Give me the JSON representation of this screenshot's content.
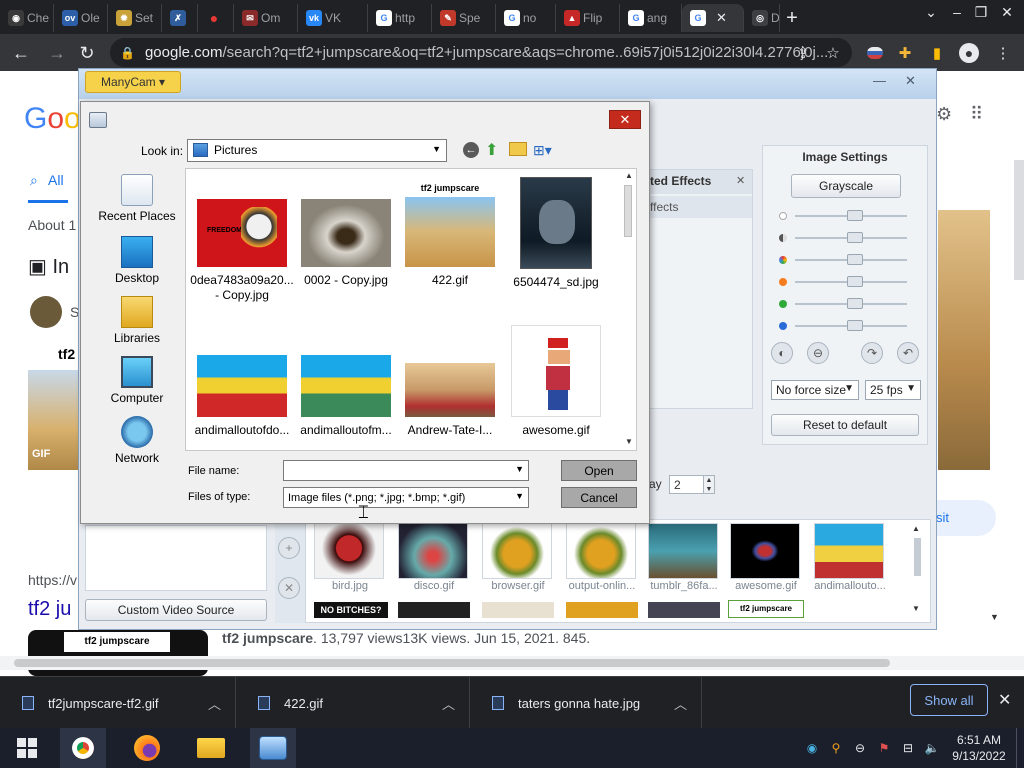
{
  "browser": {
    "tabs": [
      {
        "label": "Che"
      },
      {
        "label": "Ole"
      },
      {
        "label": "Set"
      },
      {
        "label": ""
      },
      {
        "label": ""
      },
      {
        "label": "Om"
      },
      {
        "label": "VK"
      },
      {
        "label": "http"
      },
      {
        "label": "Spe"
      },
      {
        "label": "no"
      },
      {
        "label": "Flip"
      },
      {
        "label": "ang"
      },
      {
        "label": ""
      },
      {
        "label": "De"
      }
    ],
    "active_tab_close": "✕",
    "url_domain": "google.com",
    "url_rest": "/search?q=tf2+jumpscare&oq=tf2+jumpscare&aqs=chrome..69i57j0i512j0i22i30l4.2776j0j..."
  },
  "google": {
    "tab_all": "All",
    "about": "About 1",
    "images_label": "In",
    "result_url": "https://v",
    "result_title": "tf2 ju",
    "result_snippet_bold": "tf2 jumpscare",
    "result_snippet": ". 13,797 views13K views. Jun 15, 2021. 845.",
    "thumb_caption": "tf2",
    "thumb_caption2": "GIF",
    "right_link": "sit",
    "video_thumb_text": "tf2 jumpscare"
  },
  "manycam": {
    "menu_button": "ManyCam ▾",
    "image_settings_title": "Image Settings",
    "grayscale_button": "Grayscale",
    "effects_header": "ted Effects",
    "effects_item": "ffects",
    "force_size": "No force size",
    "fps": "25 fps",
    "reset_button": "Reset to default",
    "delay_label": "ay",
    "delay_value": "2",
    "custom_video_source": "Custom Video Source",
    "slider_levels": [
      0.5,
      0.5,
      0.5,
      0.5,
      0.5,
      0.5
    ],
    "thumbnails": [
      {
        "caption": "bird.jpg"
      },
      {
        "caption": "disco.gif"
      },
      {
        "caption": "browser.gif"
      },
      {
        "caption": "output-onlin..."
      },
      {
        "caption": "tumblr_86fa..."
      },
      {
        "caption": "awesome.gif"
      },
      {
        "caption": "andimallouto..."
      }
    ],
    "thumb_row2_text": "NO BITCHES?",
    "thumb_row2_tf2": "tf2 jumpscare"
  },
  "dialog": {
    "look_in_label": "Look in:",
    "look_in_value": "Pictures",
    "places": [
      {
        "label": "Recent Places"
      },
      {
        "label": "Desktop"
      },
      {
        "label": "Libraries"
      },
      {
        "label": "Computer"
      },
      {
        "label": "Network"
      }
    ],
    "files": [
      {
        "name1": "0dea7483a09a20...",
        "name2": "- Copy.jpg",
        "flag_text": "FREEDOM"
      },
      {
        "name1": "0002 - Copy.jpg",
        "name2": ""
      },
      {
        "name1": "422.gif",
        "name2": "",
        "thumb_text": "tf2 jumpscare"
      },
      {
        "name1": "6504474_sd.jpg",
        "name2": ""
      },
      {
        "name1": "andimalloutofdo...",
        "name2": ""
      },
      {
        "name1": "andimalloutofm...",
        "name2": ""
      },
      {
        "name1": "Andrew-Tate-I...",
        "name2": ""
      },
      {
        "name1": "awesome.gif",
        "name2": ""
      }
    ],
    "file_name_label": "File name:",
    "file_name_value": "",
    "files_of_type_label": "Files of type:",
    "files_of_type_value": "Image files (*.png; *.jpg; *.bmp; *.gif)",
    "open_button": "Open",
    "cancel_button": "Cancel"
  },
  "downloads": {
    "items": [
      {
        "name": "tf2jumpscare-tf2.gif"
      },
      {
        "name": "422.gif"
      },
      {
        "name": "taters gonna hate.jpg"
      }
    ],
    "show_all": "Show all"
  },
  "taskbar": {
    "time": "6:51 AM",
    "date": "9/13/2022"
  },
  "colors": {
    "chrome_dark": "#202124",
    "chrome_toolbar": "#35363a",
    "manycam_bg": "#e9edf2",
    "dialog_bg": "#f0f0f0",
    "taskbar": "#1a1f2b",
    "google_blue": "#1a0dab"
  }
}
